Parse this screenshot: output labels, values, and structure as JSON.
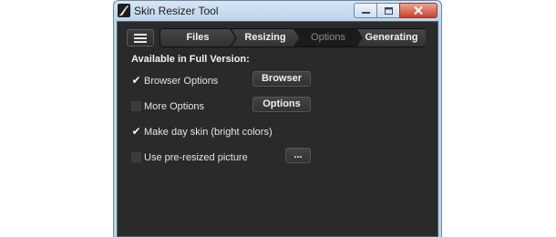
{
  "window": {
    "title": "Skin Resizer Tool",
    "accent_color": "#bcd4ea",
    "client_bg": "#2a2a2b"
  },
  "titlebar": {
    "app_icon": "brush-icon",
    "buttons": [
      "minimize-icon",
      "maximize-icon",
      "close-icon"
    ]
  },
  "toolbar": {
    "menu_icon": "hamburger-menu-icon"
  },
  "wizard": {
    "steps": [
      {
        "label": "Files",
        "state": "done"
      },
      {
        "label": "Resizing",
        "state": "done"
      },
      {
        "label": "Options",
        "state": "current"
      },
      {
        "label": "Generating",
        "state": "pending"
      }
    ]
  },
  "options": {
    "section_title": "Available in Full Version:",
    "rows": [
      {
        "label": "Browser Options",
        "checked": true,
        "button": "Browser"
      },
      {
        "label": "More Options",
        "checked": false,
        "button": "Options"
      },
      {
        "label": "Make day skin (bright colors)",
        "checked": true
      },
      {
        "label": "Use pre-resized picture",
        "checked": false,
        "button": "..."
      }
    ]
  }
}
